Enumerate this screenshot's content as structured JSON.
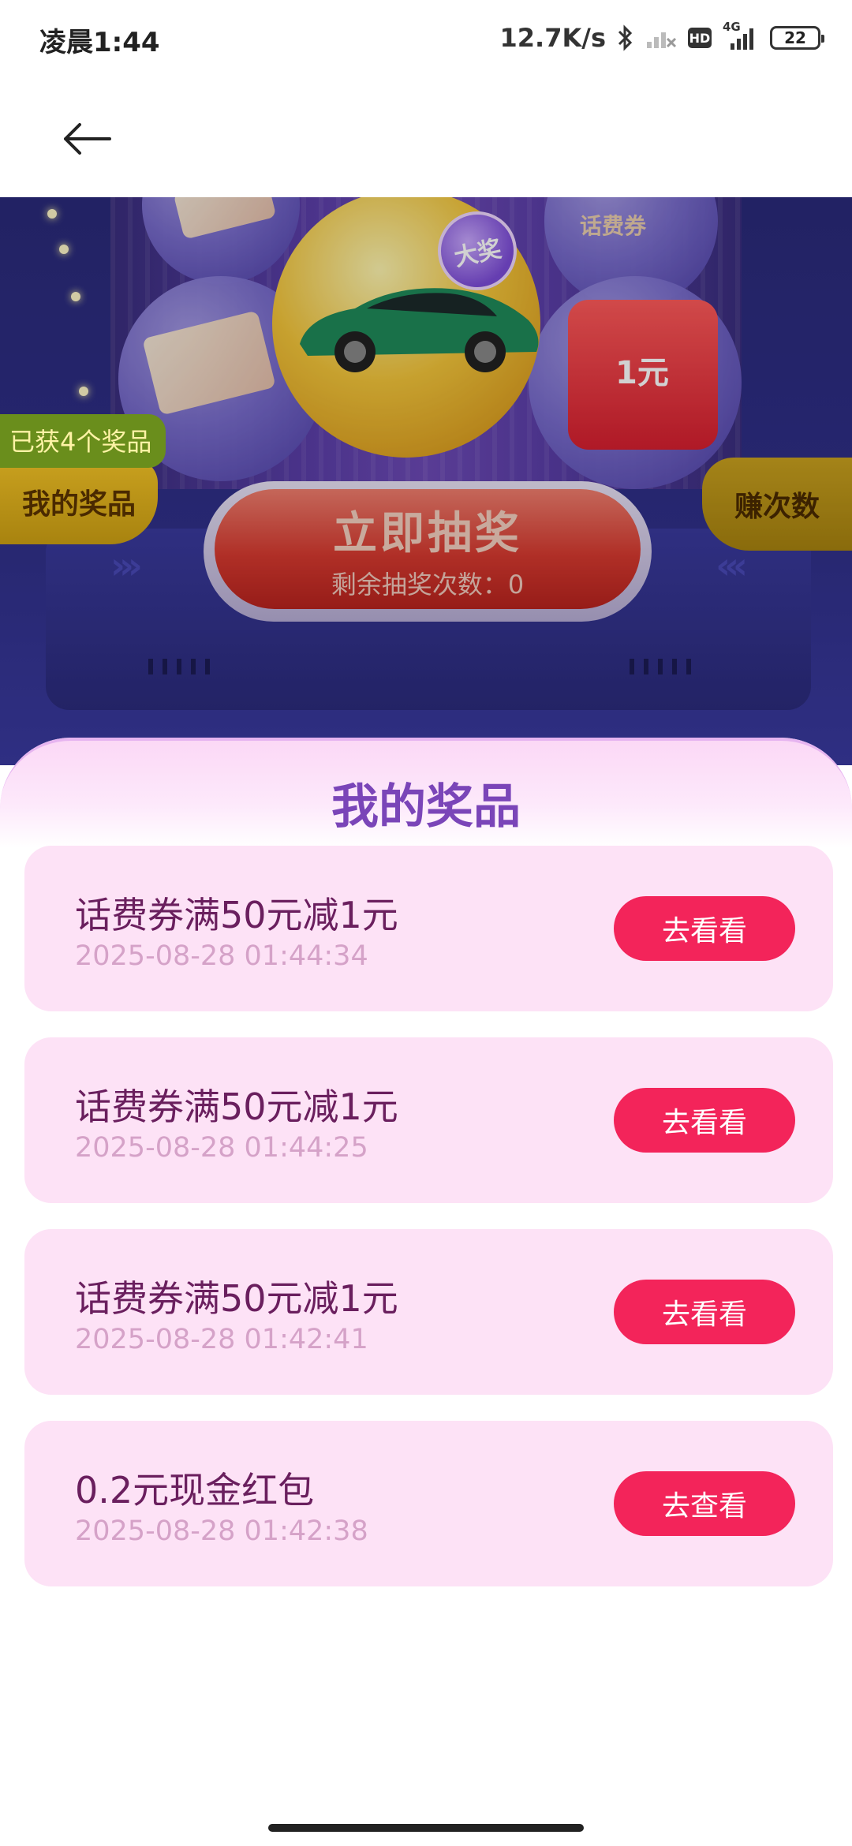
{
  "status_bar": {
    "time": "凌晨1:44",
    "net_speed": "12.7K/s",
    "hd_label": "HD",
    "network_type": "4G",
    "battery_level": "22",
    "icons": [
      "bluetooth-icon",
      "wifi-off-icon",
      "hd-icon",
      "signal-icon",
      "battery-icon"
    ]
  },
  "nav": {
    "back_icon": "arrow-left-icon"
  },
  "hero": {
    "won_count_label": "已获4个奖品",
    "my_prizes_label": "我的奖品",
    "earn_label": "赚次数",
    "draw_button_label": "立即抽奖",
    "remaining_label": "剩余抽奖次数：0",
    "grand_prize_badge": "大奖",
    "coupon_card_text": "话费券",
    "red_box_value": "1元"
  },
  "sheet": {
    "title": "我的奖品"
  },
  "prizes": [
    {
      "name": "话费券满50元减1元",
      "time": "2025-08-28 01:44:34",
      "action": "去看看"
    },
    {
      "name": "话费券满50元减1元",
      "time": "2025-08-28 01:44:25",
      "action": "去看看"
    },
    {
      "name": "话费券满50元减1元",
      "time": "2025-08-28 01:42:41",
      "action": "去看看"
    },
    {
      "name": "0.2元现金红包",
      "time": "2025-08-28 01:42:38",
      "action": "去查看"
    }
  ],
  "colors": {
    "accent_button": "#f3245a",
    "card_background": "#fde2f6",
    "sheet_title": "#7a45b8",
    "prize_name": "#6a1f5e",
    "prize_time": "#d5a2c8"
  }
}
